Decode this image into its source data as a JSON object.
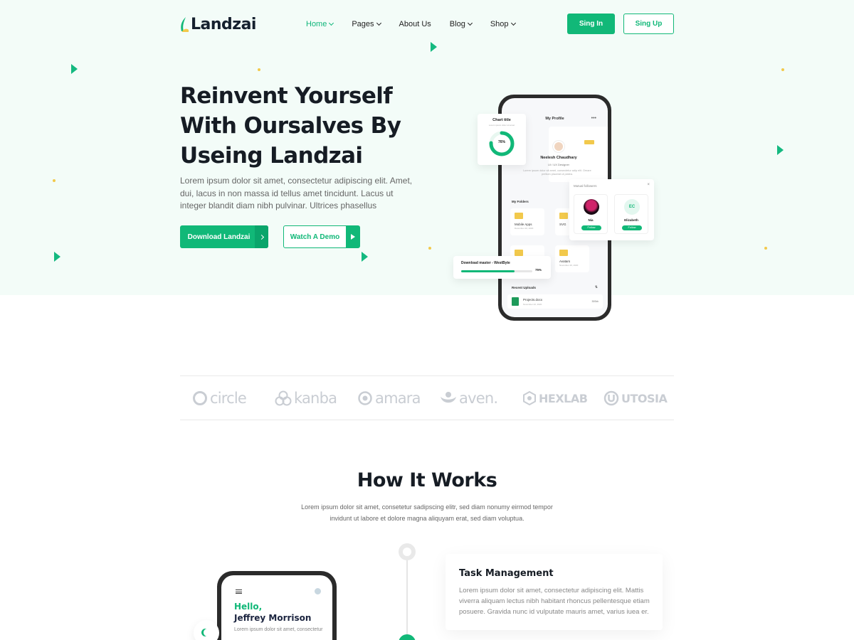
{
  "brand": {
    "name": "Landzai",
    "accent": "#11b878",
    "dark": "#161c24"
  },
  "nav": [
    {
      "label": "Home",
      "dropdown": true,
      "active": true
    },
    {
      "label": "Pages",
      "dropdown": true
    },
    {
      "label": "About Us",
      "dropdown": false
    },
    {
      "label": "Blog",
      "dropdown": true
    },
    {
      "label": "Shop",
      "dropdown": true
    }
  ],
  "auth": {
    "signin": "Sing In",
    "signup": "Sing Up"
  },
  "hero": {
    "title": "Reinvent Yourself With Oursalves By Useing Landzai",
    "description": "Lorem ipsum dolor sit amet, consectetur adipiscing elit. Amet, dui, lacus in non massa id tellus amet tincidunt. Lacus ut integer blandit diam nibh pulvinar. Ultrices phasellus",
    "download_label": "Download Landzai",
    "demo_label": "Watch A Demo"
  },
  "mockup": {
    "screen_title": "My Profile",
    "profile_name": "Neelesh Chaudhary",
    "profile_role": "UI / UX Designer",
    "profile_desc": "Lorem ipsum dolor sit amet, consectetur adip elit. Ornare pretium placerat ut platea.",
    "folders_label": "My Folders",
    "folders": [
      {
        "name": "Mobile Apps",
        "date": "December 20, 2020"
      },
      {
        "name": "SVG",
        "date": ""
      },
      {
        "name": "",
        "date": ""
      },
      {
        "name": "Avatars",
        "date": "November 20, 2020"
      }
    ],
    "recent_label": "Recent Uploads",
    "recent_sort": "⇅",
    "recent_file": {
      "name": "Projects.docx",
      "date": "November 22, 2020",
      "size": "300kb"
    },
    "chart_card": {
      "title": "Chart title",
      "subtitle": "Lorem ipsum dolor sit amet",
      "percent": "76%",
      "value": 76
    },
    "followers_card": {
      "title": "Mutual followers",
      "close": "×",
      "people": [
        {
          "name": "Nia",
          "initials": "",
          "follow": "Follow"
        },
        {
          "name": "Elizabeth",
          "initials": "EC",
          "follow": "Follow"
        }
      ]
    },
    "download_card": {
      "title": "Download master - WestByte",
      "percent": "75%",
      "progress": 75
    }
  },
  "partners": [
    {
      "name": "circle",
      "icon": "ring-icon"
    },
    {
      "name": "kanba",
      "icon": "trefoil-icon"
    },
    {
      "name": "amara",
      "icon": "target-icon"
    },
    {
      "name": "aven.",
      "icon": "flower-icon"
    },
    {
      "name": "HEXLAB",
      "icon": "hexagon-icon"
    },
    {
      "name": "UTOSIA",
      "icon": "u-circle-icon"
    }
  ],
  "how_it_works": {
    "title": "How It Works",
    "description": "Lorem ipsum dolor sit amet, consetetur sadipscing elitr, sed diam nonumy eirmod tempor invidunt ut labore et dolore magna aliquyam erat, sed diam voluptua.",
    "step_title": "Task Management",
    "step_desc": "Lorem ipsum dolor sit amet, consectetur adipiscing elit. Mattis viverra aliquam lectus nibh habitant rhoncus pellentesque etiam posuere. Gravida nunc id vulputate mauris amet, varius iuea er.",
    "phone_greeting": "Hello,",
    "phone_name": "Jeffrey Morrison",
    "phone_text": "Lorem ipsum dolor sit amet, consectetur"
  }
}
